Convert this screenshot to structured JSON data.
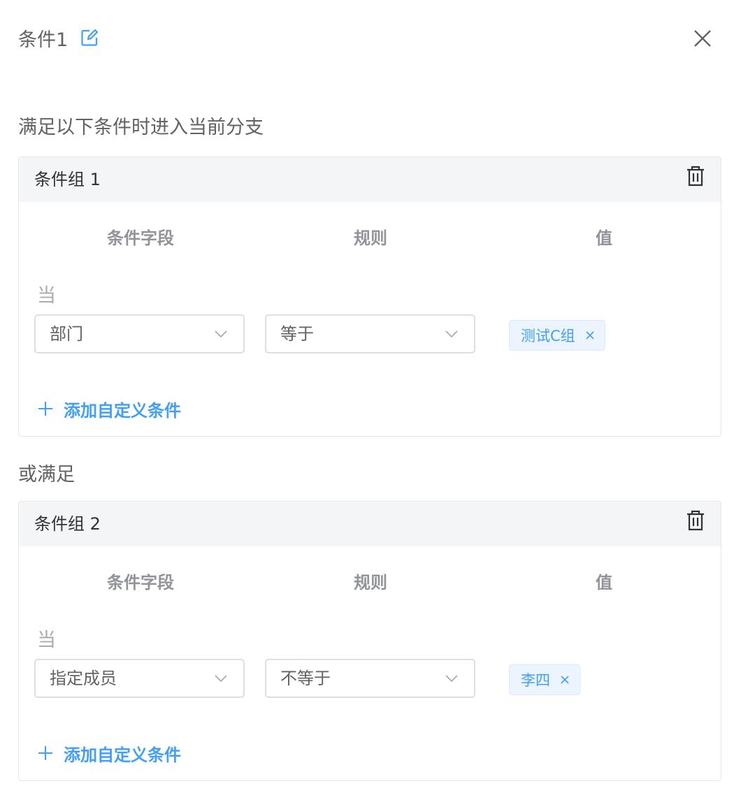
{
  "header": {
    "title": "条件1"
  },
  "subtitle": "满足以下条件时进入当前分支",
  "or_label": "或满足",
  "columns": {
    "field": "条件字段",
    "rule": "规则",
    "value": "值"
  },
  "groups": [
    {
      "title": "条件组 1",
      "when": "当",
      "field_value": "部门",
      "rule_value": "等于",
      "tag": "测试C组",
      "add_label": "添加自定义条件"
    },
    {
      "title": "条件组 2",
      "when": "当",
      "field_value": "指定成员",
      "rule_value": "不等于",
      "tag": "李四",
      "add_label": "添加自定义条件"
    }
  ],
  "icons": {
    "edit": "edit-icon",
    "close": "close-icon",
    "trash": "trash-icon",
    "chevron": "chevron-down-icon",
    "tag_close": "close-icon",
    "plus": "plus-icon"
  },
  "colors": {
    "accent": "#409eff",
    "tag_bg": "#ecf5ff",
    "header_bg": "#f4f5f7",
    "border": "#dcdfe6"
  }
}
